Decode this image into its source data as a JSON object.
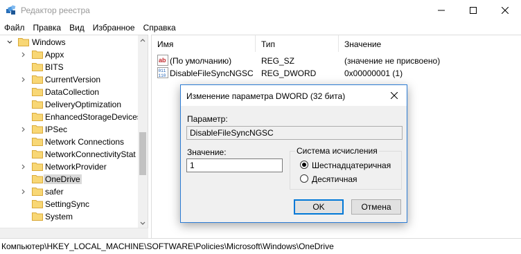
{
  "window": {
    "title": "Редактор реестра",
    "app_icon": "regedit-icon",
    "controls": {
      "minimize": "minimize-icon",
      "maximize": "maximize-icon",
      "close": "close-icon"
    }
  },
  "menu": [
    "Файл",
    "Правка",
    "Вид",
    "Избранное",
    "Справка"
  ],
  "tree": {
    "root": "Windows",
    "items": [
      {
        "label": "Appx",
        "has_children": true
      },
      {
        "label": "BITS",
        "has_children": false
      },
      {
        "label": "CurrentVersion",
        "has_children": true
      },
      {
        "label": "DataCollection",
        "has_children": false
      },
      {
        "label": "DeliveryOptimization",
        "has_children": false
      },
      {
        "label": "EnhancedStorageDevices",
        "has_children": false
      },
      {
        "label": "IPSec",
        "has_children": true
      },
      {
        "label": "Network Connections",
        "has_children": false
      },
      {
        "label": "NetworkConnectivityStat",
        "has_children": false
      },
      {
        "label": "NetworkProvider",
        "has_children": true
      },
      {
        "label": "OneDrive",
        "has_children": false,
        "selected": true
      },
      {
        "label": "safer",
        "has_children": true
      },
      {
        "label": "SettingSync",
        "has_children": false
      },
      {
        "label": "System",
        "has_children": false
      }
    ]
  },
  "list": {
    "headers": {
      "name": "Имя",
      "type": "Тип",
      "value": "Значение"
    },
    "rows": [
      {
        "icon": "string-value-icon",
        "name": "(По умолчанию)",
        "type": "REG_SZ",
        "value": "(значение не присвоено)"
      },
      {
        "icon": "binary-value-icon",
        "name": "DisableFileSyncNGSC",
        "type": "REG_DWORD",
        "value": "0x00000001 (1)"
      }
    ]
  },
  "status": {
    "path": "Компьютер\\HKEY_LOCAL_MACHINE\\SOFTWARE\\Policies\\Microsoft\\Windows\\OneDrive"
  },
  "dialog": {
    "title": "Изменение параметра DWORD (32 бита)",
    "param_label": "Параметр:",
    "param_value": "DisableFileSyncNGSC",
    "value_label": "Значение:",
    "value_value": "1",
    "base_label": "Система исчисления",
    "hex_label": "Шестнадцатеричная",
    "dec_label": "Десятичная",
    "hex_selected": true,
    "ok_label": "OK",
    "cancel_label": "Отмена"
  },
  "colors": {
    "folder": "#f8d775",
    "folder_edge": "#d9a93a",
    "selection": "#d9d9d9",
    "accent": "#0078d7"
  }
}
